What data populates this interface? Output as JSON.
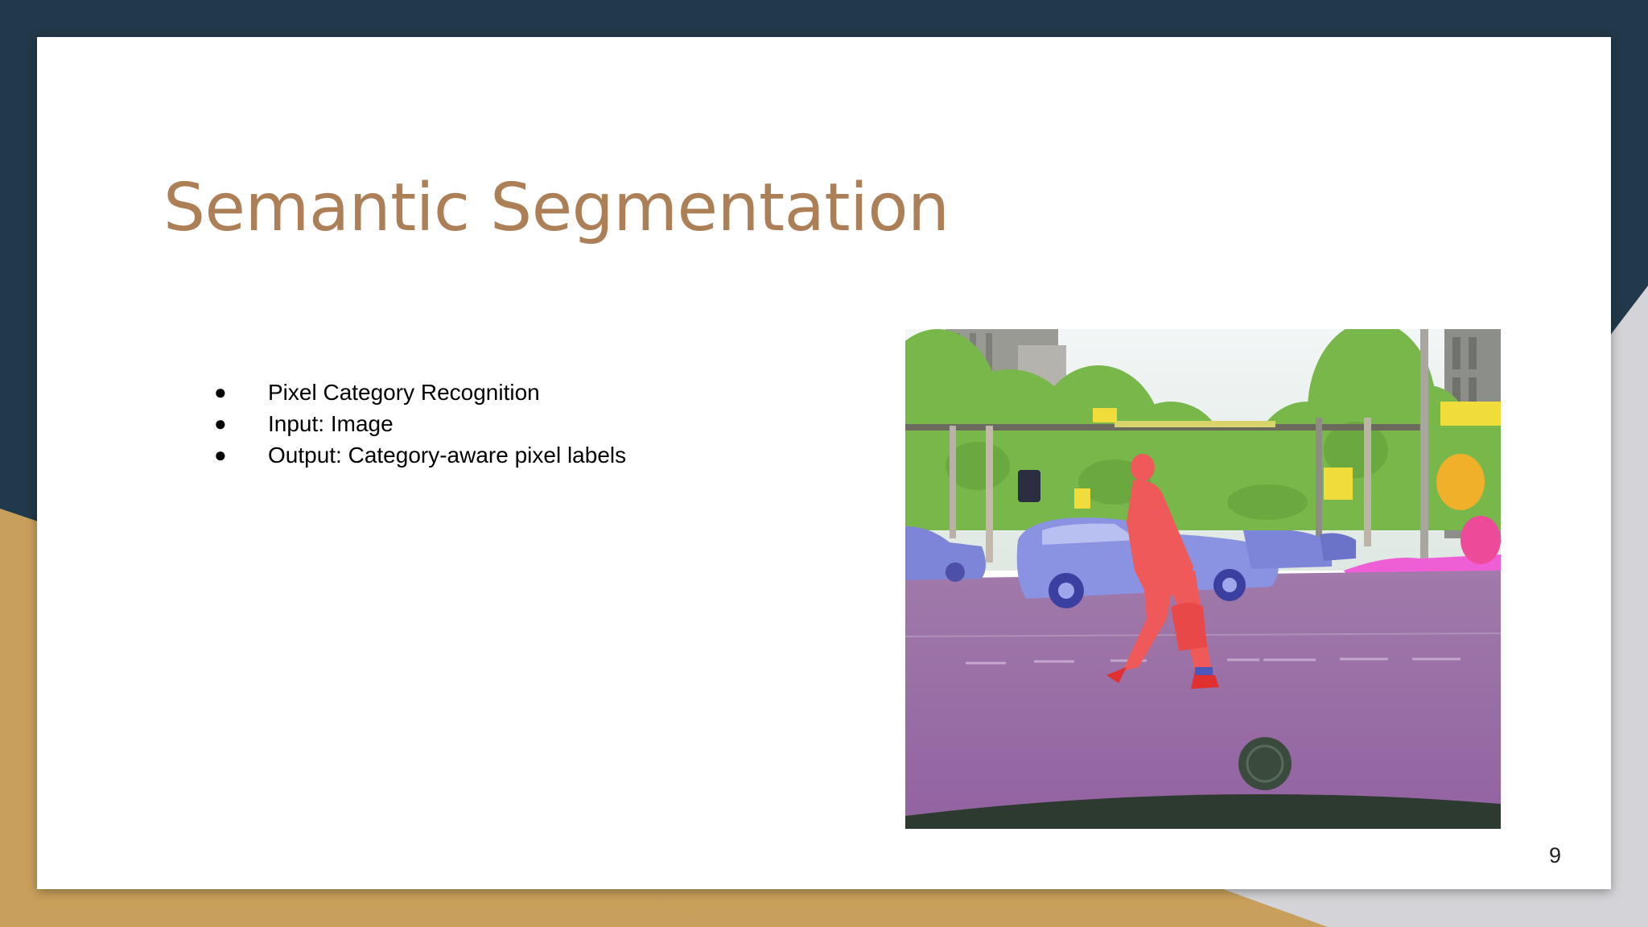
{
  "slide": {
    "title": "Semantic Segmentation",
    "bullets": [
      {
        "marker": "●",
        "text": "Pixel Category Recognition"
      },
      {
        "marker": "●",
        "text": "Input: Image"
      },
      {
        "marker": "●",
        "text": "Output: Category-aware pixel labels"
      }
    ],
    "page_number": "9"
  },
  "image": {
    "name": "street-scene-segmentation",
    "labels_visible": [
      "road",
      "vegetation",
      "car",
      "person",
      "pole",
      "traffic-sign",
      "sky",
      "building",
      "sidewalk"
    ]
  },
  "colors": {
    "background_dark": "#21394a",
    "accent_gold": "#c9a05b",
    "accent_grey": "#d4d4d8",
    "title_color": "#ad7f56",
    "road": "#9a6ba6",
    "vegetation": "#76b947",
    "car": "#7e84dc",
    "person": "#ef5a5a",
    "sign": "#f0e040",
    "sidewalk": "#ee66dd",
    "sky": "#e8eef0"
  }
}
